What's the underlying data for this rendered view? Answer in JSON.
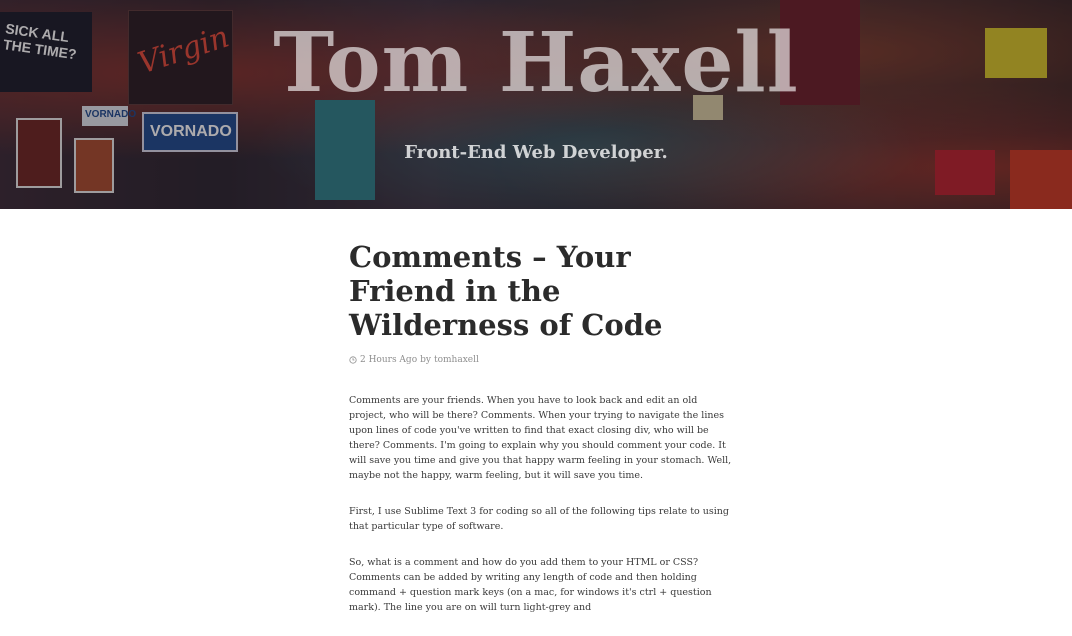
{
  "hero": {
    "title": "Tom Haxell",
    "tagline": "Front-End Web Developer.",
    "signs": {
      "virgin": "Virgin",
      "vornado": "VORNADO",
      "vornado_small": "VORNADO",
      "sick": "SICK ALL THE TIME?"
    }
  },
  "post": {
    "title": "Comments – Your Friend in the Wilderness of Code",
    "meta": {
      "time": "2 Hours Ago",
      "by_label": "by",
      "author": "tomhaxell"
    },
    "paragraphs": [
      "Comments are your friends. When you have to look back and edit an old project, who will be there? Comments. When your trying to navigate the lines upon lines of code you've written to find that exact closing div, who will be there? Comments. I'm going to explain why you should comment your code. It will save you time and give you that happy warm feeling in your stomach. Well, maybe not the happy, warm feeling, but it will save you time.",
      "First, I use Sublime Text 3 for coding so all of the following tips relate to using that particular type of software.",
      "So, what is a comment and how do you add them to your HTML or CSS? Comments can be added by writing any length of code and then holding command + question mark keys (on a mac, for windows it's ctrl + question mark). The line you are on will turn light-grey and"
    ]
  },
  "colors": {
    "title_text": "#2b2b2b",
    "body_text": "#3a3a3a",
    "meta_text": "#8f8f8f",
    "background": "#ffffff"
  }
}
